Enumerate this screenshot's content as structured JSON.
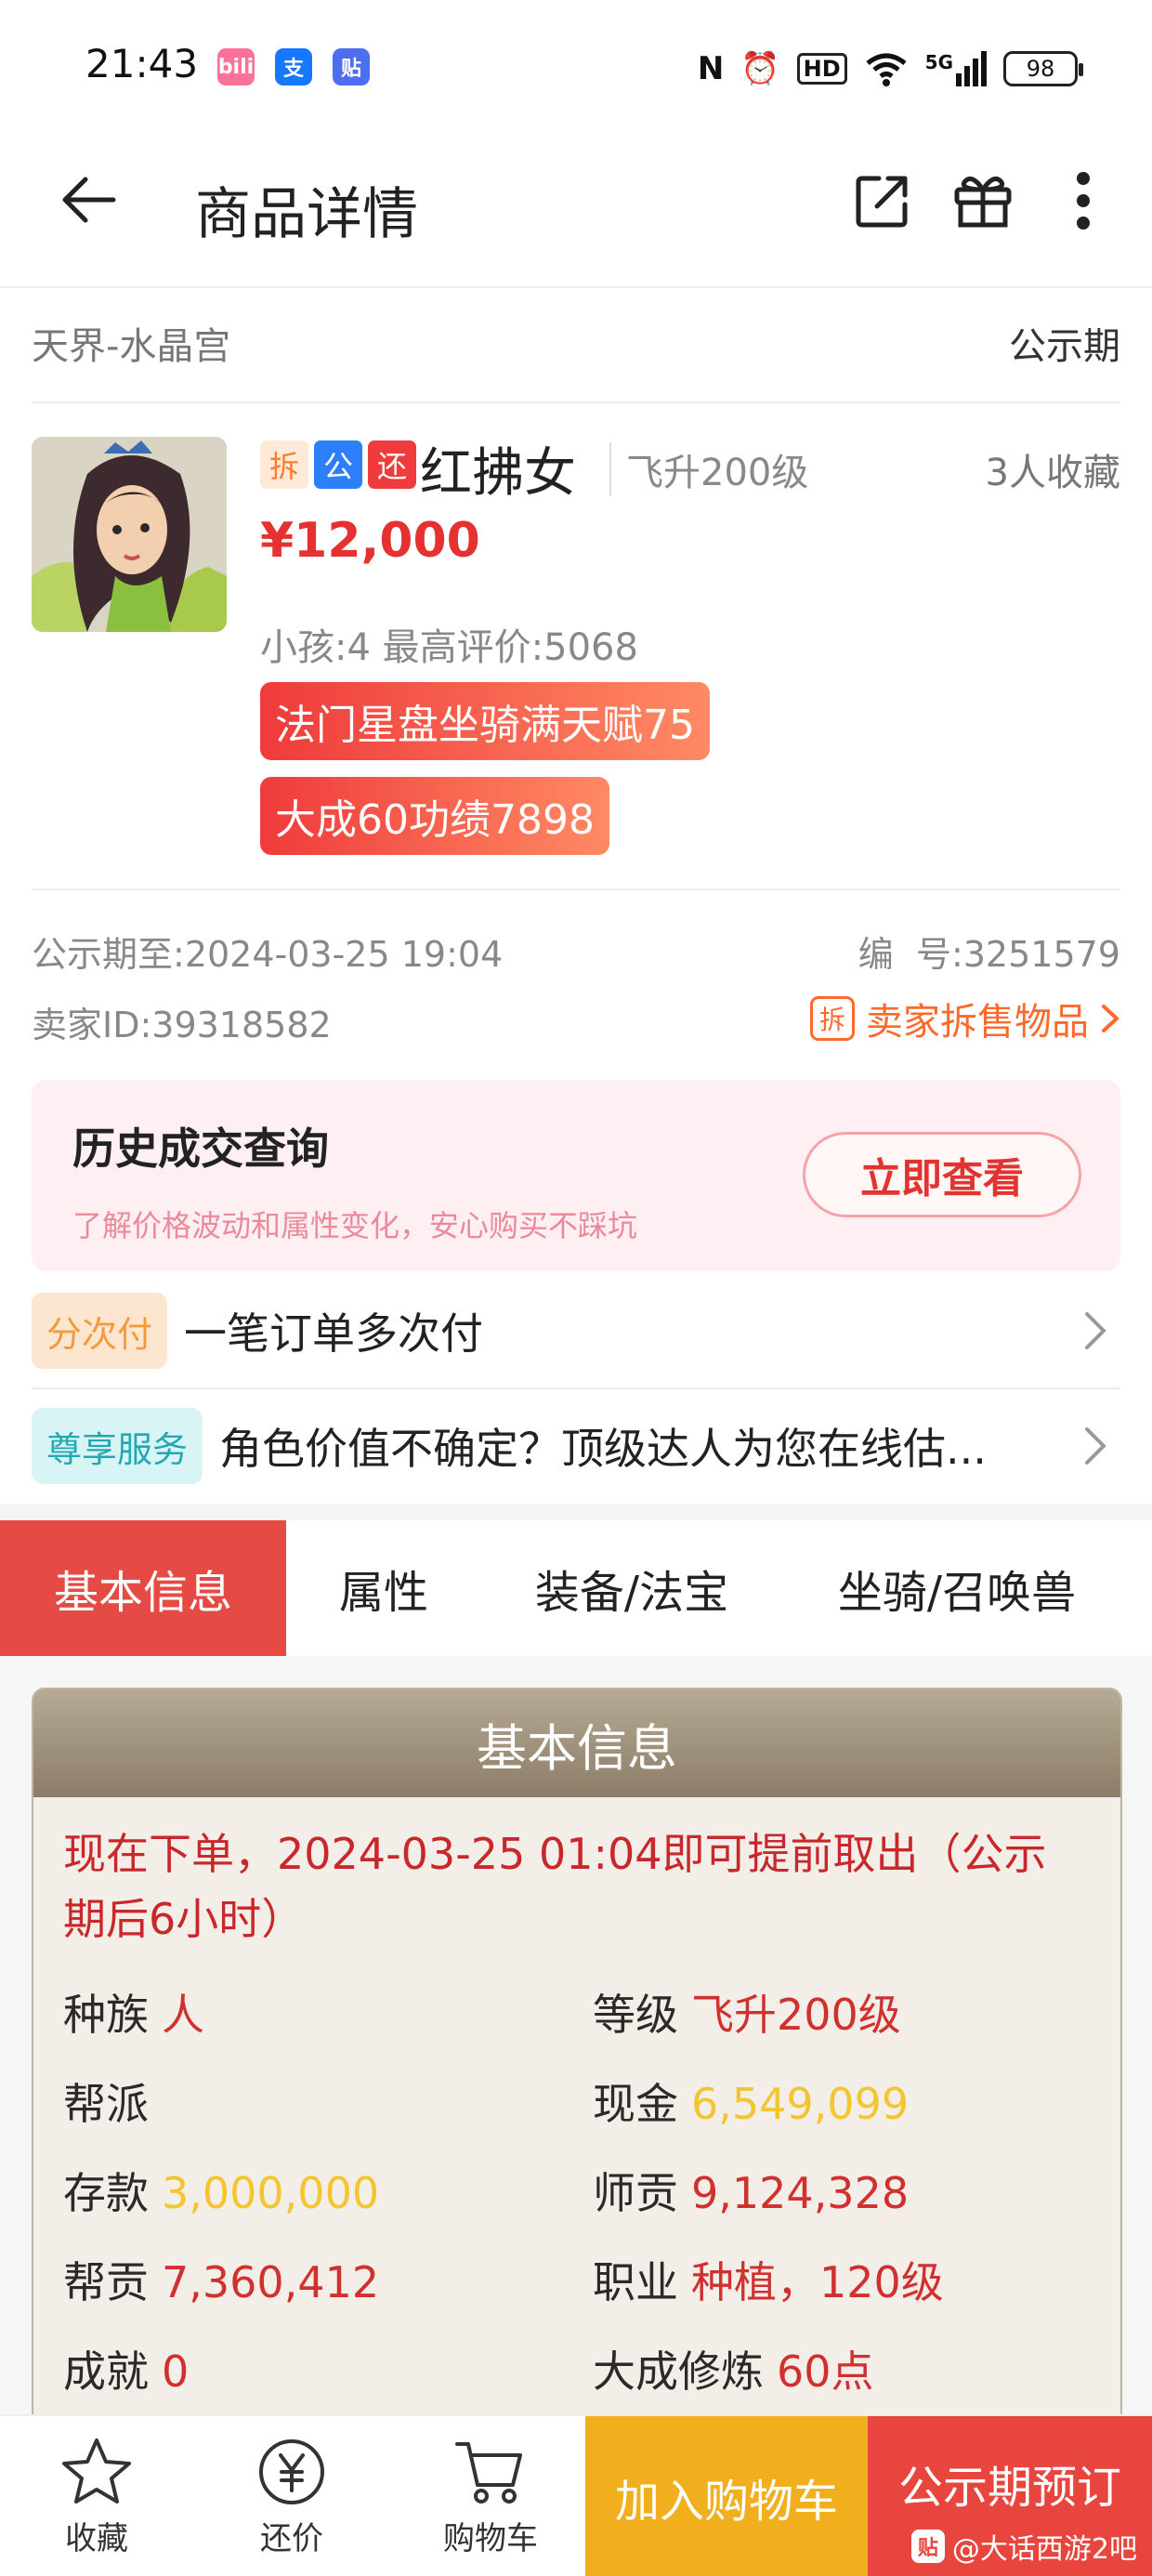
{
  "status_bar": {
    "time": "21:43",
    "apps": [
      {
        "icon": "bilibili-icon",
        "text": "bili",
        "color": "#fb7299"
      },
      {
        "icon": "alipay-icon",
        "text": "支",
        "color": "#1677ff"
      },
      {
        "icon": "tieba-icon",
        "text": "贴",
        "color": "#4e6ef2"
      }
    ],
    "network": "5G",
    "hd": "HD",
    "battery": "98"
  },
  "header": {
    "title": "商品详情",
    "icons": [
      "back-arrow-icon",
      "share-icon",
      "gift-icon",
      "more-icon"
    ]
  },
  "location": {
    "server": "天界-水晶宫",
    "status": "公示期"
  },
  "product": {
    "tags": [
      "拆",
      "公",
      "还"
    ],
    "tag_colors": [
      "#ff9a3c",
      "#2d7ff9",
      "#ef3b3b"
    ],
    "name": "红拂女",
    "level": "飞升200级",
    "favorites": "3人收藏",
    "price": "¥12,000",
    "info": "小孩:4 最高评价:5068",
    "highlights": [
      "法门星盘坐骑满天赋75",
      "大成60功绩7898"
    ]
  },
  "meta": {
    "period_label": "公示期至:",
    "period_value": "2024-03-25 19:04",
    "id_label": "编  号:",
    "id_value": "3251579",
    "seller_label": "卖家ID:",
    "seller_value": "39318582",
    "seller_link": "卖家拆售物品",
    "seller_link_icon": "拆"
  },
  "history": {
    "title": "历史成交查询",
    "subtitle": "了解价格波动和属性变化，安心购买不踩坑",
    "button": "立即查看"
  },
  "services": [
    {
      "badge": "分次付",
      "text": "一笔订单多次付"
    },
    {
      "badge": "尊享服务",
      "text": "角色价值不确定？顶级达人为您在线估..."
    }
  ],
  "tabs": [
    "基本信息",
    "属性",
    "装备/法宝",
    "坐骑/召唤兽"
  ],
  "detail": {
    "title": "基本信息",
    "notice_line1": "现在下单，2024-03-25 01:04即可提前取出（公示",
    "notice_line2": "期后6小时）",
    "fields": {
      "race_label": "种族",
      "race_value": "人",
      "level_label": "等级",
      "level_value": "飞升200级",
      "guild_label": "帮派",
      "guild_value": "",
      "cash_label": "现金",
      "cash_value": "6,549,099",
      "deposit_label": "存款",
      "deposit_value": "3,000,000",
      "mentor_label": "师贡",
      "mentor_value": "9,124,328",
      "guildcontrib_label": "帮贡",
      "guildcontrib_value": "7,360,412",
      "job_label": "职业",
      "job_value": "种植，120级",
      "achieve_label": "成就",
      "achieve_value": "0",
      "train_label": "大成修炼",
      "train_value": "60点"
    }
  },
  "bottom": {
    "fav": "收藏",
    "bargain": "还价",
    "cart": "购物车",
    "add_cart": "加入购物车",
    "preorder": "公示期预订",
    "watermark": "@大话西游2吧",
    "watermark_icon": "贴"
  }
}
